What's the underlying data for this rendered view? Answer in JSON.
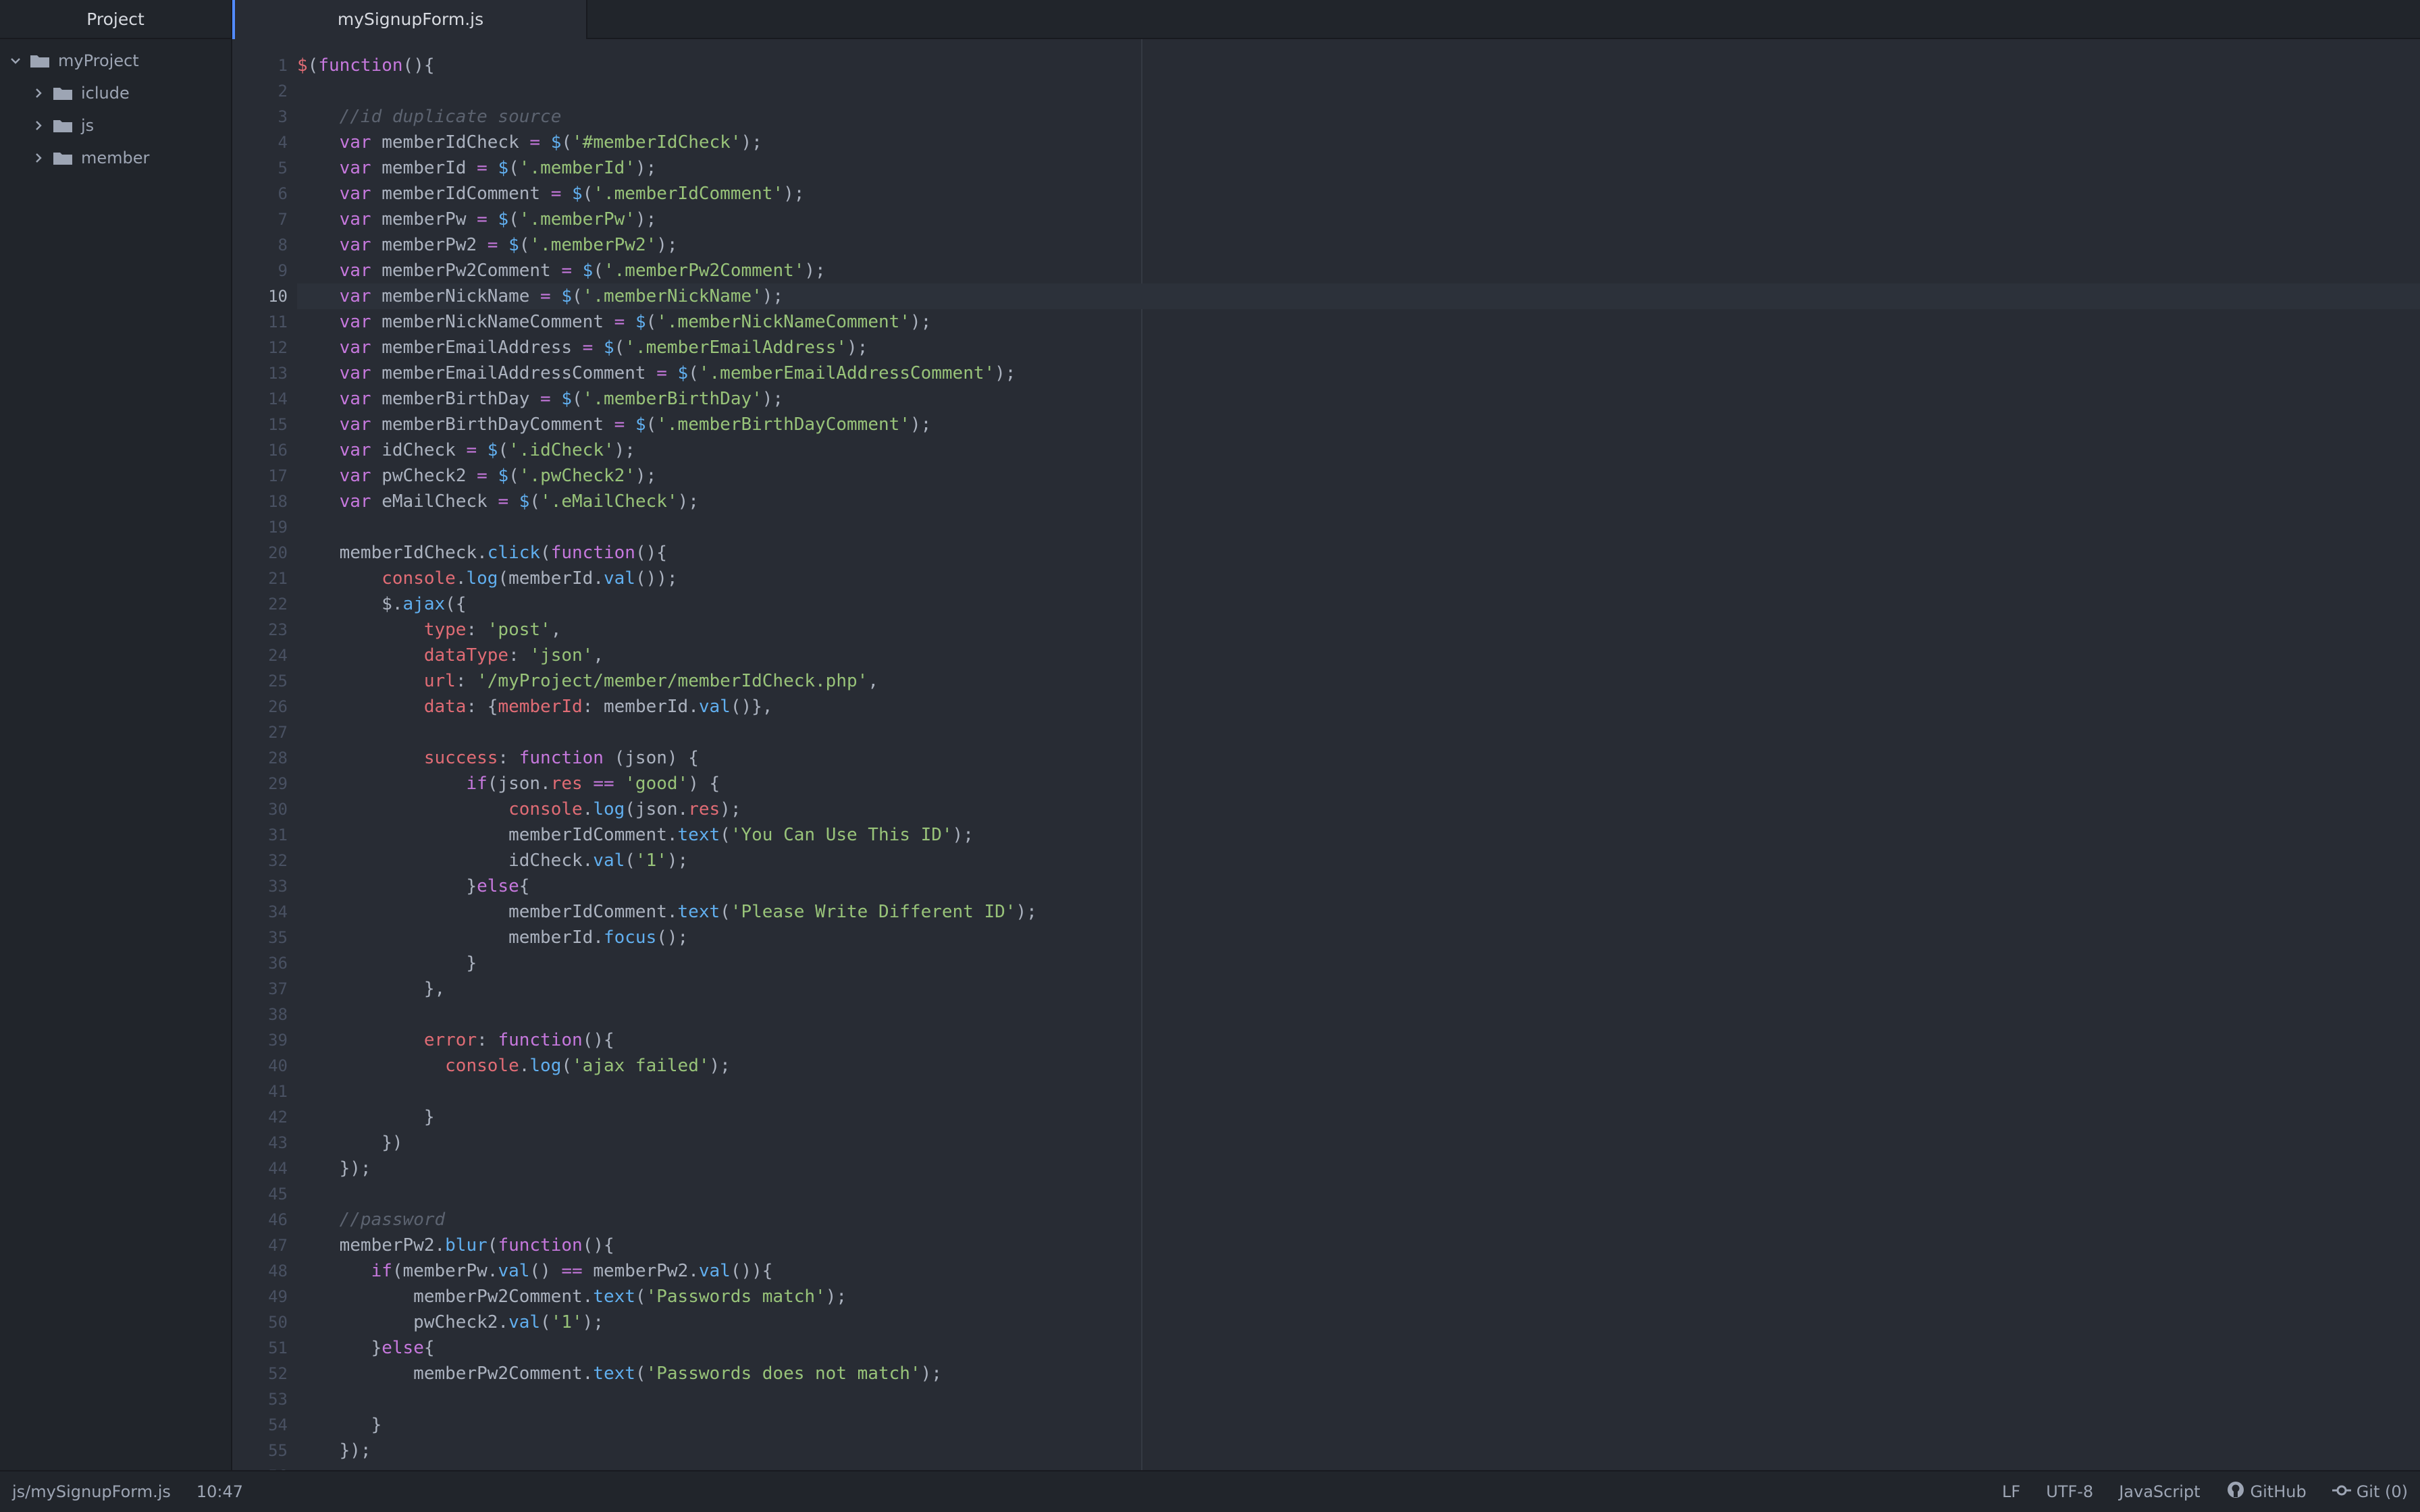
{
  "sidebar": {
    "title": "Project",
    "root": "myProject",
    "folders": [
      "iclude",
      "js",
      "member"
    ]
  },
  "tab": {
    "title": "mySignupForm.js"
  },
  "editor": {
    "current_line": 10,
    "lines": [
      [
        [
          "p",
          "$"
        ],
        [
          "t",
          "("
        ],
        [
          "k",
          "function"
        ],
        [
          "t",
          "(){"
        ]
      ],
      [],
      [
        [
          "t",
          "    "
        ],
        [
          "c",
          "//id duplicate source"
        ]
      ],
      [
        [
          "t",
          "    "
        ],
        [
          "k",
          "var"
        ],
        [
          "t",
          " memberIdCheck "
        ],
        [
          "k",
          "="
        ],
        [
          "t",
          " "
        ],
        [
          "f",
          "$"
        ],
        [
          "t",
          "("
        ],
        [
          "s",
          "'#memberIdCheck'"
        ],
        [
          "t",
          ");"
        ]
      ],
      [
        [
          "t",
          "    "
        ],
        [
          "k",
          "var"
        ],
        [
          "t",
          " memberId "
        ],
        [
          "k",
          "="
        ],
        [
          "t",
          " "
        ],
        [
          "f",
          "$"
        ],
        [
          "t",
          "("
        ],
        [
          "s",
          "'.memberId'"
        ],
        [
          "t",
          ");"
        ]
      ],
      [
        [
          "t",
          "    "
        ],
        [
          "k",
          "var"
        ],
        [
          "t",
          " memberIdComment "
        ],
        [
          "k",
          "="
        ],
        [
          "t",
          " "
        ],
        [
          "f",
          "$"
        ],
        [
          "t",
          "("
        ],
        [
          "s",
          "'.memberIdComment'"
        ],
        [
          "t",
          ");"
        ]
      ],
      [
        [
          "t",
          "    "
        ],
        [
          "k",
          "var"
        ],
        [
          "t",
          " memberPw "
        ],
        [
          "k",
          "="
        ],
        [
          "t",
          " "
        ],
        [
          "f",
          "$"
        ],
        [
          "t",
          "("
        ],
        [
          "s",
          "'.memberPw'"
        ],
        [
          "t",
          ");"
        ]
      ],
      [
        [
          "t",
          "    "
        ],
        [
          "k",
          "var"
        ],
        [
          "t",
          " memberPw2 "
        ],
        [
          "k",
          "="
        ],
        [
          "t",
          " "
        ],
        [
          "f",
          "$"
        ],
        [
          "t",
          "("
        ],
        [
          "s",
          "'.memberPw2'"
        ],
        [
          "t",
          ");"
        ]
      ],
      [
        [
          "t",
          "    "
        ],
        [
          "k",
          "var"
        ],
        [
          "t",
          " memberPw2Comment "
        ],
        [
          "k",
          "="
        ],
        [
          "t",
          " "
        ],
        [
          "f",
          "$"
        ],
        [
          "t",
          "("
        ],
        [
          "s",
          "'.memberPw2Comment'"
        ],
        [
          "t",
          ");"
        ]
      ],
      [
        [
          "t",
          "    "
        ],
        [
          "k",
          "var"
        ],
        [
          "t",
          " memberNickName "
        ],
        [
          "k",
          "="
        ],
        [
          "t",
          " "
        ],
        [
          "f",
          "$"
        ],
        [
          "t",
          "("
        ],
        [
          "s",
          "'.memberNickName'"
        ],
        [
          "t",
          ");"
        ]
      ],
      [
        [
          "t",
          "    "
        ],
        [
          "k",
          "var"
        ],
        [
          "t",
          " memberNickNameComment "
        ],
        [
          "k",
          "="
        ],
        [
          "t",
          " "
        ],
        [
          "f",
          "$"
        ],
        [
          "t",
          "("
        ],
        [
          "s",
          "'.memberNickNameComment'"
        ],
        [
          "t",
          ");"
        ]
      ],
      [
        [
          "t",
          "    "
        ],
        [
          "k",
          "var"
        ],
        [
          "t",
          " memberEmailAddress "
        ],
        [
          "k",
          "="
        ],
        [
          "t",
          " "
        ],
        [
          "f",
          "$"
        ],
        [
          "t",
          "("
        ],
        [
          "s",
          "'.memberEmailAddress'"
        ],
        [
          "t",
          ");"
        ]
      ],
      [
        [
          "t",
          "    "
        ],
        [
          "k",
          "var"
        ],
        [
          "t",
          " memberEmailAddressComment "
        ],
        [
          "k",
          "="
        ],
        [
          "t",
          " "
        ],
        [
          "f",
          "$"
        ],
        [
          "t",
          "("
        ],
        [
          "s",
          "'.memberEmailAddressComment'"
        ],
        [
          "t",
          ");"
        ]
      ],
      [
        [
          "t",
          "    "
        ],
        [
          "k",
          "var"
        ],
        [
          "t",
          " memberBirthDay "
        ],
        [
          "k",
          "="
        ],
        [
          "t",
          " "
        ],
        [
          "f",
          "$"
        ],
        [
          "t",
          "("
        ],
        [
          "s",
          "'.memberBirthDay'"
        ],
        [
          "t",
          ");"
        ]
      ],
      [
        [
          "t",
          "    "
        ],
        [
          "k",
          "var"
        ],
        [
          "t",
          " memberBirthDayComment "
        ],
        [
          "k",
          "="
        ],
        [
          "t",
          " "
        ],
        [
          "f",
          "$"
        ],
        [
          "t",
          "("
        ],
        [
          "s",
          "'.memberBirthDayComment'"
        ],
        [
          "t",
          ");"
        ]
      ],
      [
        [
          "t",
          "    "
        ],
        [
          "k",
          "var"
        ],
        [
          "t",
          " idCheck "
        ],
        [
          "k",
          "="
        ],
        [
          "t",
          " "
        ],
        [
          "f",
          "$"
        ],
        [
          "t",
          "("
        ],
        [
          "s",
          "'.idCheck'"
        ],
        [
          "t",
          ");"
        ]
      ],
      [
        [
          "t",
          "    "
        ],
        [
          "k",
          "var"
        ],
        [
          "t",
          " pwCheck2 "
        ],
        [
          "k",
          "="
        ],
        [
          "t",
          " "
        ],
        [
          "f",
          "$"
        ],
        [
          "t",
          "("
        ],
        [
          "s",
          "'.pwCheck2'"
        ],
        [
          "t",
          ");"
        ]
      ],
      [
        [
          "t",
          "    "
        ],
        [
          "k",
          "var"
        ],
        [
          "t",
          " eMailCheck "
        ],
        [
          "k",
          "="
        ],
        [
          "t",
          " "
        ],
        [
          "f",
          "$"
        ],
        [
          "t",
          "("
        ],
        [
          "s",
          "'.eMailCheck'"
        ],
        [
          "t",
          ");"
        ]
      ],
      [],
      [
        [
          "t",
          "    memberIdCheck."
        ],
        [
          "f",
          "click"
        ],
        [
          "t",
          "("
        ],
        [
          "k",
          "function"
        ],
        [
          "t",
          "(){"
        ]
      ],
      [
        [
          "t",
          "        "
        ],
        [
          "p",
          "console"
        ],
        [
          "t",
          "."
        ],
        [
          "f",
          "log"
        ],
        [
          "t",
          "(memberId."
        ],
        [
          "f",
          "val"
        ],
        [
          "t",
          "());"
        ]
      ],
      [
        [
          "t",
          "        $."
        ],
        [
          "f",
          "ajax"
        ],
        [
          "t",
          "({"
        ]
      ],
      [
        [
          "t",
          "            "
        ],
        [
          "p",
          "type"
        ],
        [
          "t",
          ": "
        ],
        [
          "s",
          "'post'"
        ],
        [
          "t",
          ","
        ]
      ],
      [
        [
          "t",
          "            "
        ],
        [
          "p",
          "dataType"
        ],
        [
          "t",
          ": "
        ],
        [
          "s",
          "'json'"
        ],
        [
          "t",
          ","
        ]
      ],
      [
        [
          "t",
          "            "
        ],
        [
          "p",
          "url"
        ],
        [
          "t",
          ": "
        ],
        [
          "s",
          "'/myProject/member/memberIdCheck.php'"
        ],
        [
          "t",
          ","
        ]
      ],
      [
        [
          "t",
          "            "
        ],
        [
          "p",
          "data"
        ],
        [
          "t",
          ": {"
        ],
        [
          "p",
          "memberId"
        ],
        [
          "t",
          ": memberId."
        ],
        [
          "f",
          "val"
        ],
        [
          "t",
          "()},"
        ]
      ],
      [],
      [
        [
          "t",
          "            "
        ],
        [
          "p",
          "success"
        ],
        [
          "t",
          ": "
        ],
        [
          "k",
          "function"
        ],
        [
          "t",
          " (json) {"
        ]
      ],
      [
        [
          "t",
          "                "
        ],
        [
          "k",
          "if"
        ],
        [
          "t",
          "(json."
        ],
        [
          "p",
          "res"
        ],
        [
          "t",
          " "
        ],
        [
          "k",
          "=="
        ],
        [
          "t",
          " "
        ],
        [
          "s",
          "'good'"
        ],
        [
          "t",
          ") {"
        ]
      ],
      [
        [
          "t",
          "                    "
        ],
        [
          "p",
          "console"
        ],
        [
          "t",
          "."
        ],
        [
          "f",
          "log"
        ],
        [
          "t",
          "(json."
        ],
        [
          "p",
          "res"
        ],
        [
          "t",
          ");"
        ]
      ],
      [
        [
          "t",
          "                    memberIdComment."
        ],
        [
          "f",
          "text"
        ],
        [
          "t",
          "("
        ],
        [
          "s",
          "'You Can Use This ID'"
        ],
        [
          "t",
          ");"
        ]
      ],
      [
        [
          "t",
          "                    idCheck."
        ],
        [
          "f",
          "val"
        ],
        [
          "t",
          "("
        ],
        [
          "s",
          "'1'"
        ],
        [
          "t",
          ");"
        ]
      ],
      [
        [
          "t",
          "                }"
        ],
        [
          "k",
          "else"
        ],
        [
          "t",
          "{"
        ]
      ],
      [
        [
          "t",
          "                    memberIdComment."
        ],
        [
          "f",
          "text"
        ],
        [
          "t",
          "("
        ],
        [
          "s",
          "'Please Write Different ID'"
        ],
        [
          "t",
          ");"
        ]
      ],
      [
        [
          "t",
          "                    memberId."
        ],
        [
          "f",
          "focus"
        ],
        [
          "t",
          "();"
        ]
      ],
      [
        [
          "t",
          "                }"
        ]
      ],
      [
        [
          "t",
          "            },"
        ]
      ],
      [],
      [
        [
          "t",
          "            "
        ],
        [
          "p",
          "error"
        ],
        [
          "t",
          ": "
        ],
        [
          "k",
          "function"
        ],
        [
          "t",
          "(){"
        ]
      ],
      [
        [
          "t",
          "              "
        ],
        [
          "p",
          "console"
        ],
        [
          "t",
          "."
        ],
        [
          "f",
          "log"
        ],
        [
          "t",
          "("
        ],
        [
          "s",
          "'ajax failed'"
        ],
        [
          "t",
          ");"
        ]
      ],
      [],
      [
        [
          "t",
          "            }"
        ]
      ],
      [
        [
          "t",
          "        })"
        ]
      ],
      [
        [
          "t",
          "    });"
        ]
      ],
      [],
      [
        [
          "t",
          "    "
        ],
        [
          "c",
          "//password"
        ]
      ],
      [
        [
          "t",
          "    memberPw2."
        ],
        [
          "f",
          "blur"
        ],
        [
          "t",
          "("
        ],
        [
          "k",
          "function"
        ],
        [
          "t",
          "(){"
        ]
      ],
      [
        [
          "t",
          "       "
        ],
        [
          "k",
          "if"
        ],
        [
          "t",
          "(memberPw."
        ],
        [
          "f",
          "val"
        ],
        [
          "t",
          "() "
        ],
        [
          "k",
          "=="
        ],
        [
          "t",
          " memberPw2."
        ],
        [
          "f",
          "val"
        ],
        [
          "t",
          "()){"
        ]
      ],
      [
        [
          "t",
          "           memberPw2Comment."
        ],
        [
          "f",
          "text"
        ],
        [
          "t",
          "("
        ],
        [
          "s",
          "'Passwords match'"
        ],
        [
          "t",
          ");"
        ]
      ],
      [
        [
          "t",
          "           pwCheck2."
        ],
        [
          "f",
          "val"
        ],
        [
          "t",
          "("
        ],
        [
          "s",
          "'1'"
        ],
        [
          "t",
          ");"
        ]
      ],
      [
        [
          "t",
          "       }"
        ],
        [
          "k",
          "else"
        ],
        [
          "t",
          "{"
        ]
      ],
      [
        [
          "t",
          "           memberPw2Comment."
        ],
        [
          "f",
          "text"
        ],
        [
          "t",
          "("
        ],
        [
          "s",
          "'Passwords does not match'"
        ],
        [
          "t",
          ");"
        ]
      ],
      [],
      [
        [
          "t",
          "       }"
        ]
      ],
      [
        [
          "t",
          "    });"
        ]
      ],
      []
    ]
  },
  "status": {
    "file_path": "js/mySignupForm.js",
    "cursor": "10:47",
    "line_ending": "LF",
    "encoding": "UTF-8",
    "grammar": "JavaScript",
    "github": "GitHub",
    "git": "Git (0)"
  },
  "colors": {
    "background": "#282c34",
    "panel": "#21252b",
    "accent": "#528bff",
    "keyword": "#c678dd",
    "string": "#98c379",
    "function": "#61afef",
    "property": "#e06c75"
  },
  "icons": {
    "chevron_down": "chevron-down-icon",
    "chevron_right": "chevron-right-icon",
    "folder": "folder-icon",
    "github": "github-icon",
    "git": "git-commit-icon"
  }
}
